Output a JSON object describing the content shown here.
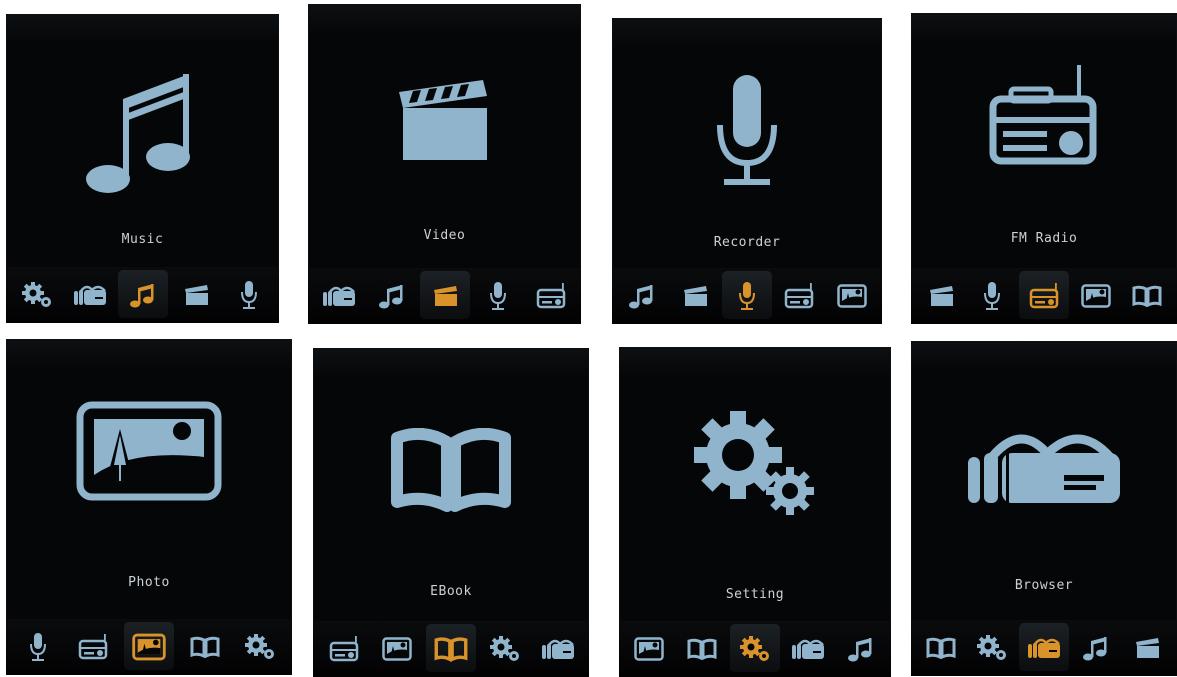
{
  "colors": {
    "icon": "#8fb4cc",
    "selected": "#d9932a",
    "label": "#c9d2d8",
    "screen": "#050607"
  },
  "screens": [
    {
      "label": "Music",
      "icon": "music-icon",
      "menu": [
        "gear-icon",
        "browser-icon",
        "music-icon",
        "video-icon",
        "microphone-icon"
      ],
      "selected": 2
    },
    {
      "label": "Video",
      "icon": "video-icon",
      "menu": [
        "browser-icon",
        "music-icon",
        "video-icon",
        "microphone-icon",
        "radio-icon"
      ],
      "selected": 2
    },
    {
      "label": "Recorder",
      "icon": "microphone-icon",
      "menu": [
        "music-icon",
        "video-icon",
        "microphone-icon",
        "radio-icon",
        "photo-icon"
      ],
      "selected": 2
    },
    {
      "label": "FM Radio",
      "icon": "radio-icon",
      "menu": [
        "video-icon",
        "microphone-icon",
        "radio-icon",
        "photo-icon",
        "book-icon"
      ],
      "selected": 2
    },
    {
      "label": "Photo",
      "icon": "photo-icon",
      "menu": [
        "microphone-icon",
        "radio-icon",
        "photo-icon",
        "book-icon",
        "gear-icon"
      ],
      "selected": 2
    },
    {
      "label": "EBook",
      "icon": "book-icon",
      "menu": [
        "radio-icon",
        "photo-icon",
        "book-icon",
        "gear-icon",
        "browser-icon"
      ],
      "selected": 2
    },
    {
      "label": "Setting",
      "icon": "gear-icon",
      "menu": [
        "photo-icon",
        "book-icon",
        "gear-icon",
        "browser-icon",
        "music-icon"
      ],
      "selected": 2
    },
    {
      "label": "Browser",
      "icon": "browser-icon",
      "menu": [
        "book-icon",
        "gear-icon",
        "browser-icon",
        "music-icon",
        "video-icon"
      ],
      "selected": 2
    }
  ]
}
